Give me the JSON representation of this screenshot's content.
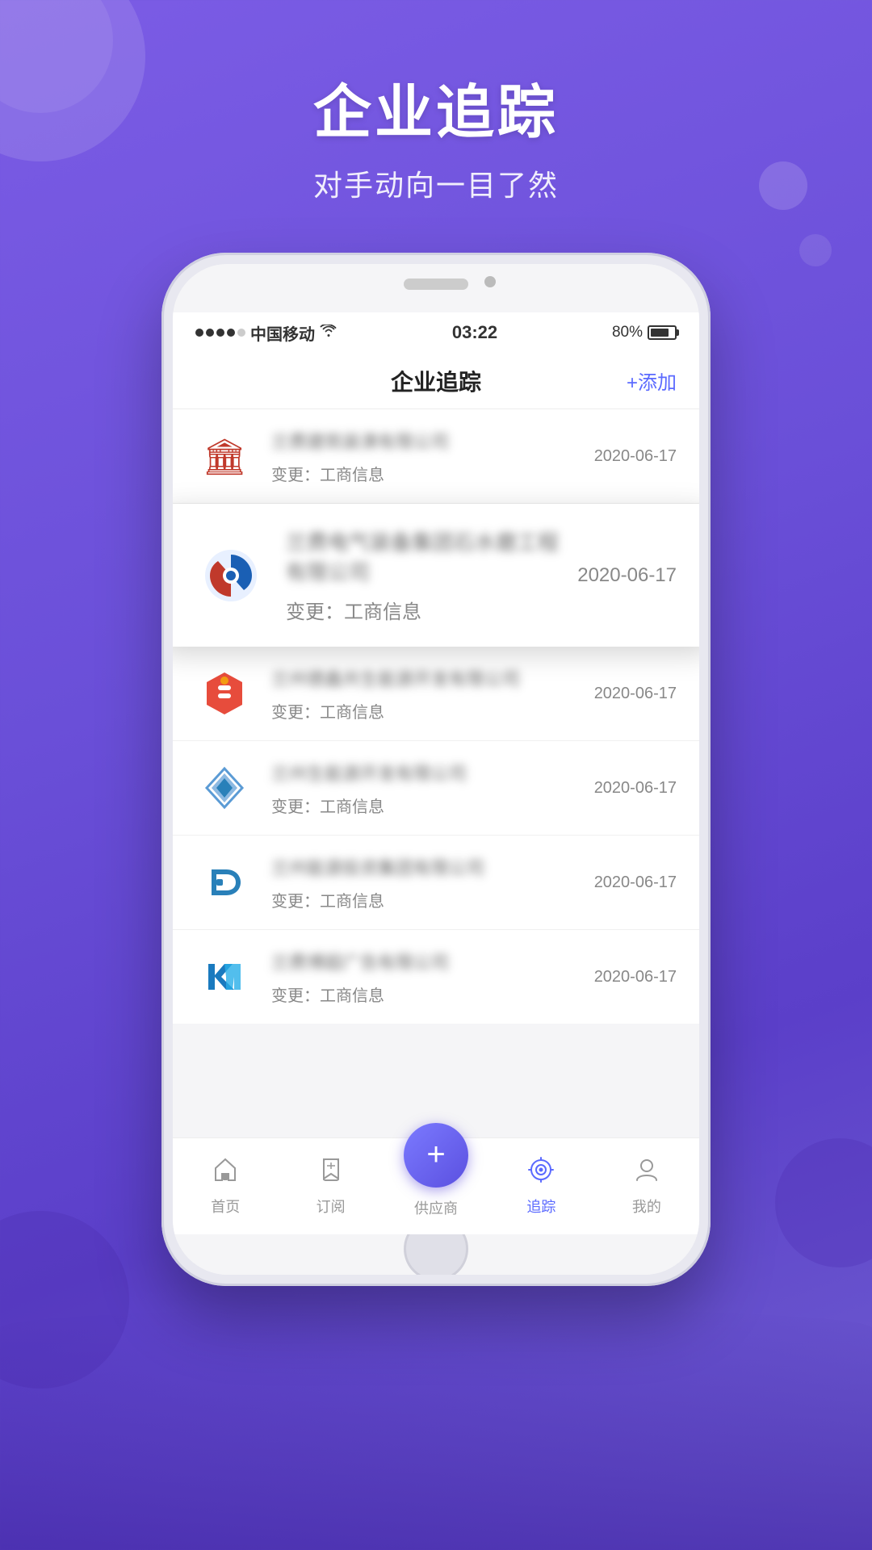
{
  "page": {
    "background_gradient_start": "#7b5ce5",
    "background_gradient_end": "#5b3fc9"
  },
  "header": {
    "main_title": "企业追踪",
    "sub_title": "对手动向一目了然"
  },
  "phone": {
    "status_bar": {
      "carrier": "中国移动",
      "signal_bars": 4,
      "signal_empty": 1,
      "wifi": true,
      "time": "03:22",
      "battery_percent": "80%"
    },
    "app_header": {
      "title": "企业追踪",
      "add_button": "+添加"
    },
    "companies": [
      {
        "id": 1,
        "name": "兰费建筑装潢有限公司",
        "change_label": "变更：工商信息",
        "date": "2020-06-17",
        "logo_type": "red-building",
        "highlighted": false
      },
      {
        "id": 2,
        "name": "兰费电气装备集团石水磨工程有限公司",
        "change_label": "变更：工商信息",
        "date": "2020-06-17",
        "logo_type": "blue-swirl",
        "highlighted": true
      },
      {
        "id": 3,
        "name": "兰州德鑫共生能源开发有限公司",
        "change_label": "变更：工商信息",
        "date": "2020-06-17",
        "logo_type": "red-hex",
        "highlighted": false
      },
      {
        "id": 4,
        "name": "兰州生能源开发有限公司",
        "change_label": "变更：工商信息",
        "date": "2020-06-17",
        "logo_type": "diamond",
        "highlighted": false
      },
      {
        "id": 5,
        "name": "兰州能源投资集团有限公司",
        "change_label": "变更：工商信息",
        "date": "2020-06-17",
        "logo_type": "blue-dl",
        "highlighted": false
      },
      {
        "id": 6,
        "name": "兰费博超广告有限公司",
        "change_label": "变更：工商信息",
        "date": "2020-06-17",
        "logo_type": "blue-hy",
        "highlighted": false
      }
    ],
    "bottom_nav": {
      "items": [
        {
          "label": "首页",
          "icon": "home",
          "active": false
        },
        {
          "label": "订阅",
          "icon": "bookmark",
          "active": false
        },
        {
          "label": "供应商",
          "icon": "plus-center",
          "active": false,
          "center": true
        },
        {
          "label": "追踪",
          "icon": "tracking",
          "active": true
        },
        {
          "label": "我的",
          "icon": "user",
          "active": false
        }
      ]
    }
  }
}
